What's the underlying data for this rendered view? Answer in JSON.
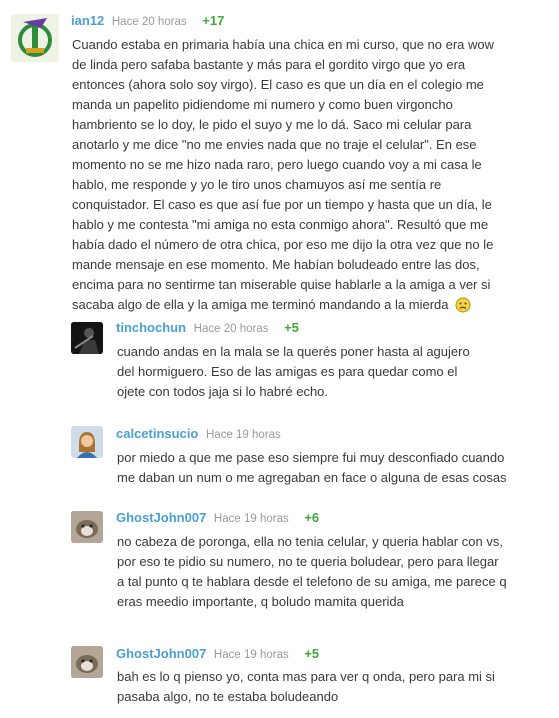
{
  "comments": [
    {
      "user": "ian12",
      "time": "Hace 20 horas",
      "score": "+17",
      "avatar_icon": "green-logo-avatar",
      "text": "Cuando estaba en primaria había una chica en mi curso, que no era wow de linda pero safaba bastante y más para el gordito virgo que yo era entonces (ahora solo soy virgo). El caso es que un día en el colegio me manda un papelito pidiendome mi numero y como buen virgoncho hambriento se lo doy, le pido el suyo y me lo dá. Saco mi celular para anotarlo y me dice \"no me envies nada que no traje el celular\". En ese momento no se me hizo nada raro, pero luego cuando voy a mi casa le hablo, me responde y yo le tiro unos chamuyos así me sentía re conquistador. El caso es que así fue por un tiempo y hasta que un día, le hablo y me contesta \"mi amiga no esta conmigo ahora\". Resultó que me había dado el número de otra chica, por eso me dijo la otra vez que no le mande mensaje en ese momento. Me habían boludeado entre las dos, encima para no sentirme tan miserable quise hablarle a la amiga a ver si sacaba algo de ella y la amiga me terminó mandando a la mierda",
      "emoji": "sad-face-icon"
    },
    {
      "user": "tinchochun",
      "time": "Hace 20 horas",
      "score": "+5",
      "avatar_icon": "dark-photo-avatar",
      "text": "cuando andas en la mala se la querés poner hasta al agujero del hormiguero. Eso de las amigas es para quedar como el ojete con todos jaja si lo habré echo."
    },
    {
      "user": "calcetinsucio",
      "time": "Hace 19 horas",
      "score": "",
      "avatar_icon": "woman-photo-avatar",
      "text": "por miedo a que me pase eso siempre fui muy desconfiado cuando me daban un num o me agregaban en face o alguna de esas cosas"
    },
    {
      "user": "GhostJohn007",
      "time": "Hace 19 horas",
      "score": "+6",
      "avatar_icon": "dog-photo-avatar",
      "text": "no cabeza de poronga, ella no tenia celular, y queria hablar con vs, por eso te pidio su numero, no te queria boludear, pero para llegar a tal punto q te hablara desde el telefono de su amiga, me parece q eras meedio importante, q boludo mamita querida"
    },
    {
      "user": "GhostJohn007",
      "time": "Hace 19 horas",
      "score": "+5",
      "avatar_icon": "dog-photo-avatar",
      "text": "bah es lo q pienso yo, conta mas para ver q onda, pero para mi si pasaba algo, no te estaba boludeando"
    }
  ],
  "colors": {
    "username": "#4a9fd4",
    "score": "#3fa83a",
    "time": "#9a9a9a",
    "text": "#3a3a3a"
  }
}
